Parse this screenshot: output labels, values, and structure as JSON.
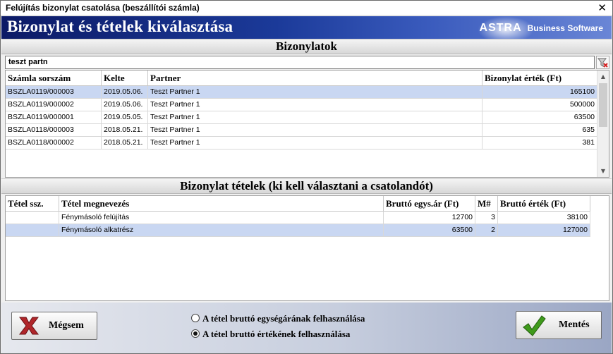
{
  "window": {
    "title": "Felújítás bizonylat csatolása (beszállítói számla)",
    "close_glyph": "✕"
  },
  "banner": {
    "heading": "Bizonylat és tételek kiválasztása",
    "logo_brand": "ASTRA",
    "logo_tagline": "Business Software"
  },
  "documents": {
    "section_title": "Bizonylatok",
    "search_value": "teszt partn",
    "columns": [
      "Számla sorszám",
      "Kelte",
      "Partner",
      "Bizonylat érték (Ft)"
    ],
    "rows": [
      [
        "BSZLA0119/000003",
        "2019.05.06.",
        "Teszt Partner 1",
        "165100"
      ],
      [
        "BSZLA0119/000002",
        "2019.05.06.",
        "Teszt Partner 1",
        "500000"
      ],
      [
        "BSZLA0119/000001",
        "2019.05.05.",
        "Teszt Partner 1",
        "63500"
      ],
      [
        "BSZLA0118/000003",
        "2018.05.21.",
        "Teszt Partner 1",
        "635"
      ],
      [
        "BSZLA0118/000002",
        "2018.05.21.",
        "Teszt Partner 1",
        "381"
      ]
    ],
    "selected_row": 0
  },
  "items": {
    "section_title": "Bizonylat tételek (ki kell választani a csatolandót)",
    "columns": [
      "Tétel ssz.",
      "Tétel megnevezés",
      "Bruttó egys.ár (Ft)",
      "M#",
      "Bruttó érték (Ft)"
    ],
    "rows": [
      [
        "",
        "Fénymásoló felújítás",
        "12700",
        "3",
        "38100"
      ],
      [
        "",
        "Fénymásoló alkatrész",
        "63500",
        "2",
        "127000"
      ]
    ],
    "selected_row": 1
  },
  "footer": {
    "cancel_label": "Mégsem",
    "save_label": "Mentés",
    "radio_unit_price": "A tétel bruttó egységárának felhasználása",
    "radio_total_value": "A tétel bruttó értékének felhasználása",
    "selected_radio": "radio_total_value"
  },
  "colors": {
    "banner_dark": "#0c1a66",
    "selection": "#c9d7f2",
    "cancel_icon": "#b0262a",
    "save_icon": "#3f9a1c"
  }
}
